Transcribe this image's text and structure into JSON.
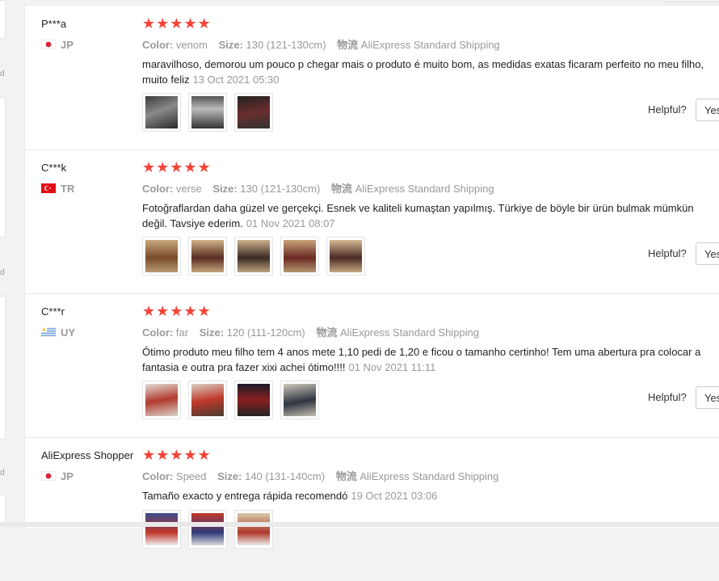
{
  "helpful_label": "Helpful?",
  "yes_label": "Yes",
  "colors": {
    "star": "#f44336",
    "muted": "#999999"
  },
  "reviews": [
    {
      "user": "P***a",
      "country": "JP",
      "flag": "japan-flag",
      "stars": "★★★★★",
      "color_label": "Color:",
      "color_value": "venom",
      "size_label": "Size:",
      "size_value": "130 (121-130cm)",
      "ship_label": "物流",
      "ship_value": "AliExpress Standard Shipping",
      "text": "maravilhoso, demorou um pouco p chegar mais o produto é muito bom, as medidas exatas ficaram perfeito no meu filho, muito feliz",
      "date": "13 Oct 2021 05:30",
      "photos": 3
    },
    {
      "user": "C***k",
      "country": "TR",
      "flag": "turkey-flag",
      "stars": "★★★★★",
      "color_label": "Color:",
      "color_value": "verse",
      "size_label": "Size:",
      "size_value": "130 (121-130cm)",
      "ship_label": "物流",
      "ship_value": "AliExpress Standard Shipping",
      "text": "Fotoğraflardan daha güzel ve gerçekçi. Esnek ve kaliteli kumaştan yapılmış. Türkiye de böyle bir ürün bulmak mümkün değil. Tavsiye ederim.",
      "date": "01 Nov 2021 08:07",
      "photos": 5
    },
    {
      "user": "C***r",
      "country": "UY",
      "flag": "uruguay-flag",
      "stars": "★★★★★",
      "color_label": "Color:",
      "color_value": "far",
      "size_label": "Size:",
      "size_value": "120 (111-120cm)",
      "ship_label": "物流",
      "ship_value": "AliExpress Standard Shipping",
      "text": "Ótimo produto meu filho tem 4 anos mete 1,10 pedi de 1,20 e ficou o tamanho certinho! Tem uma abertura pra colocar a fantasia e outra pra fazer xixi achei ótimo!!!!",
      "date": "01 Nov 2021 11:11",
      "photos": 4
    },
    {
      "user": "AliExpress Shopper",
      "country": "JP",
      "flag": "japan-flag",
      "stars": "★★★★★",
      "color_label": "Color:",
      "color_value": "Speed",
      "size_label": "Size:",
      "size_value": "140 (131-140cm)",
      "ship_label": "物流",
      "ship_value": "AliExpress Standard Shipping",
      "text": "Tamaño exacto y entrega rápida recomendó",
      "date": "19 Oct 2021 03:06",
      "photos": 3
    }
  ]
}
